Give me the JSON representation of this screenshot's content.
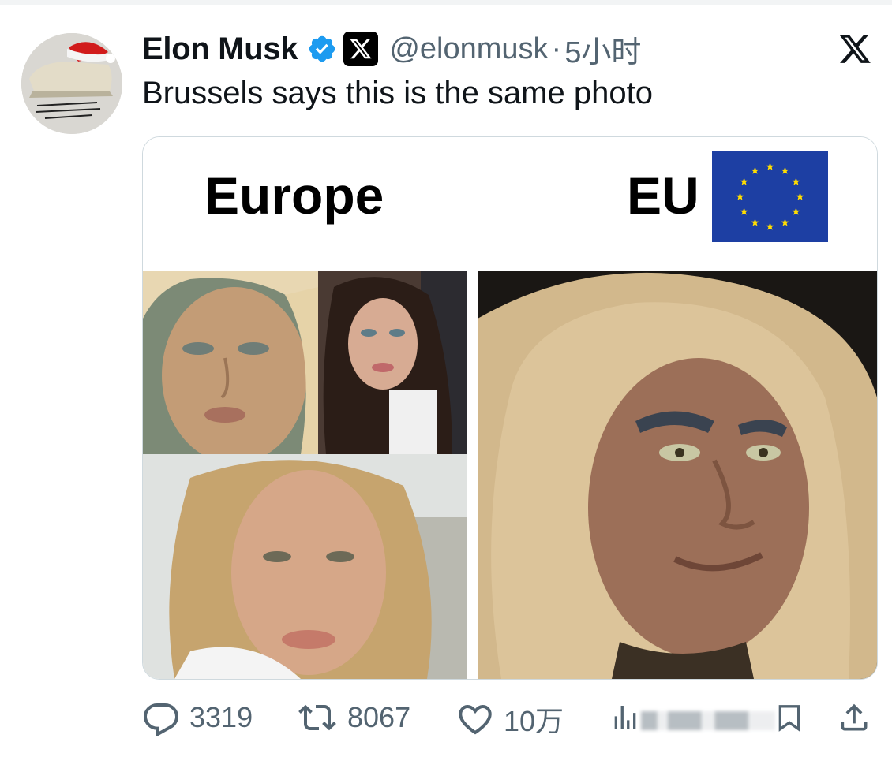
{
  "tweet": {
    "display_name": "Elon Musk",
    "handle": "@elonmusk",
    "separator": "·",
    "timestamp": "5小时",
    "text": "Brussels says this is the same photo",
    "verified": true,
    "icons": {
      "verified": "verified-badge-icon",
      "affiliation": "x-affiliation-icon",
      "logo": "x-logo-icon"
    }
  },
  "media": {
    "left_label": "Europe",
    "right_label": "EU",
    "flag": "eu-flag"
  },
  "actions": {
    "replies": "3319",
    "retweets": "8067",
    "likes": "10万",
    "views": "",
    "icons": [
      "reply-icon",
      "retweet-icon",
      "like-icon",
      "views-icon",
      "bookmark-icon",
      "share-icon"
    ]
  },
  "colors": {
    "verified_blue": "#1d9bf0",
    "secondary_text": "#536471",
    "eu_blue": "#1d3fa3",
    "eu_star": "#ffdd00"
  }
}
